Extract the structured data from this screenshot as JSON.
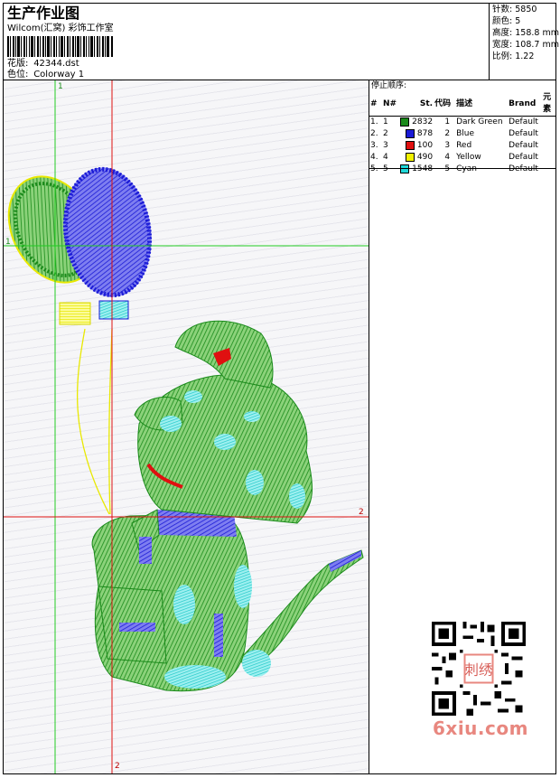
{
  "header": {
    "title": "生产作业图",
    "subtitle": "Wilcom(汇窝) 彩饰工作室",
    "design_label": "花版:",
    "design_file": "42344.dst",
    "colorway_label": "色位:",
    "colorway": "Colorway 1"
  },
  "stats": {
    "stitches_label": "针数:",
    "stitches": "5850",
    "colors_label": "颜色:",
    "colors": "5",
    "height_label": "高度:",
    "height": "158.8 mm",
    "width_label": "宽度:",
    "width": "108.7 mm",
    "scale_label": "比例:",
    "scale": "1.22"
  },
  "stop_sequence": {
    "title": "停止顺序:",
    "columns": [
      "#",
      "N#",
      "St.",
      "代码",
      "描述",
      "Brand",
      "元素"
    ],
    "rows": [
      {
        "idx": "1.",
        "n": "1",
        "color": "#1a8a1a",
        "st": "2832",
        "code": "1",
        "desc": "Dark Green",
        "brand": "Default"
      },
      {
        "idx": "2.",
        "n": "2",
        "color": "#1a1ad6",
        "st": "878",
        "code": "2",
        "desc": "Blue",
        "brand": "Default"
      },
      {
        "idx": "3.",
        "n": "3",
        "color": "#e01010",
        "st": "100",
        "code": "3",
        "desc": "Red",
        "brand": "Default"
      },
      {
        "idx": "4.",
        "n": "4",
        "color": "#f2f200",
        "st": "490",
        "code": "4",
        "desc": "Yellow",
        "brand": "Default"
      },
      {
        "idx": "5.",
        "n": "5",
        "color": "#20d8d8",
        "st": "1548",
        "code": "5",
        "desc": "Cyan",
        "brand": "Default"
      }
    ]
  },
  "design_area": {
    "axis_labels": {
      "green_top": "1",
      "green_left": "1",
      "red_right": "2",
      "red_bottom": "2"
    },
    "guide_colors": {
      "green": "#22cc22",
      "red": "#dd1111"
    }
  },
  "watermark": {
    "text": "6xiu.com",
    "stamp": "刺绣"
  }
}
